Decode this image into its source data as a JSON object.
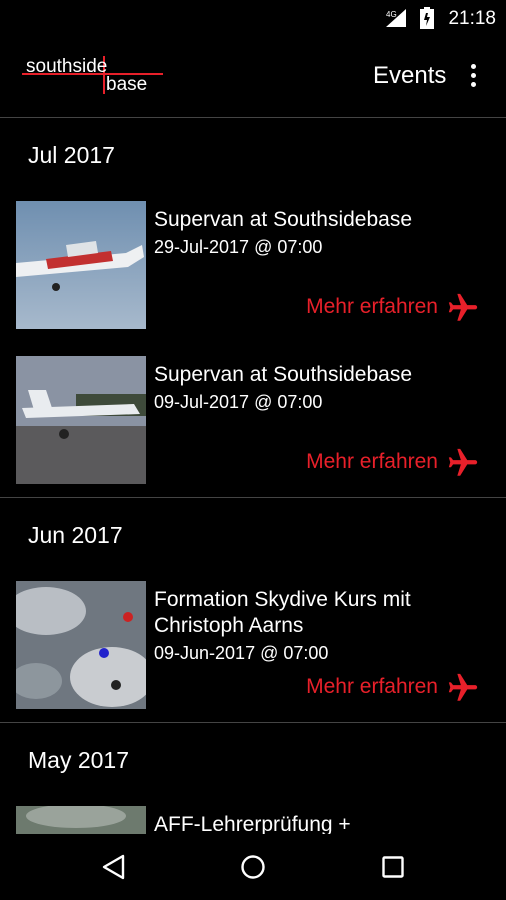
{
  "status": {
    "time": "21:18"
  },
  "appbar": {
    "title": "Events",
    "logo_text_top": "southside",
    "logo_text_bottom": "base"
  },
  "sections": [
    {
      "month": "Jul 2017"
    },
    {
      "month": "Jun 2017"
    },
    {
      "month": "May 2017"
    }
  ],
  "events": [
    {
      "title": "Supervan at Southsidebase",
      "date": "29-Jul-2017 @ 07:00",
      "more": "Mehr erfahren"
    },
    {
      "title": "Supervan at Southsidebase",
      "date": "09-Jul-2017 @ 07:00",
      "more": "Mehr erfahren"
    },
    {
      "title": "Formation Skydive Kurs mit Christoph Aarns",
      "date": "09-Jun-2017 @ 07:00",
      "more": "Mehr erfahren"
    },
    {
      "title": "AFF-Lehrerprüfung +"
    }
  ],
  "colors": {
    "accent": "#e8202a",
    "background": "#000000"
  },
  "icons": [
    "signal-icon",
    "battery-icon",
    "overflow-menu-icon",
    "airplane-icon",
    "back-icon",
    "home-icon",
    "recents-icon"
  ]
}
